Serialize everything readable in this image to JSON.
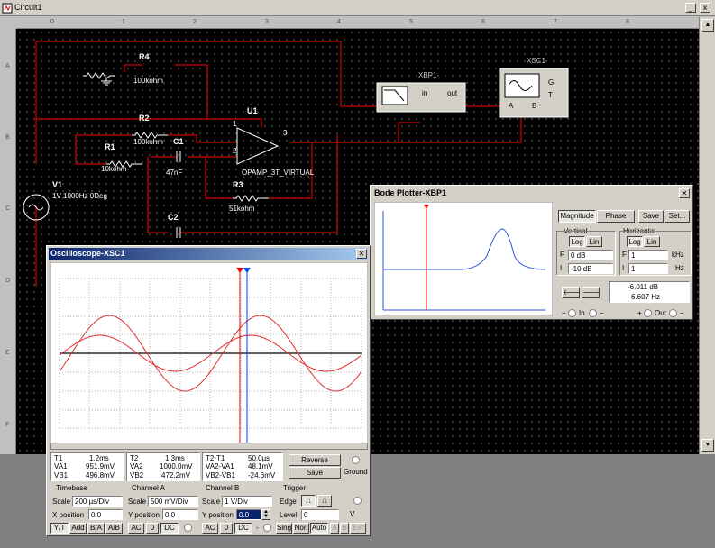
{
  "window": {
    "title": "Circuit1",
    "min": "_",
    "close": "x"
  },
  "ruler": {
    "cols": [
      "0",
      "1",
      "2",
      "3",
      "4",
      "5",
      "6",
      "7",
      "8"
    ],
    "rows": [
      "A",
      "B",
      "C",
      "D",
      "E",
      "F"
    ]
  },
  "schematic": {
    "r4": {
      "name": "R4",
      "value": "100kohm"
    },
    "r2": {
      "name": "R2",
      "value": "100kohm"
    },
    "r1": {
      "name": "R1",
      "value": "10kohm"
    },
    "c1": {
      "name": "C1",
      "value": "47nF"
    },
    "r3": {
      "name": "R3",
      "value": "51kohm"
    },
    "c2": {
      "name": "C2"
    },
    "u1": {
      "name": "U1",
      "model": "OPAMP_3T_VIRTUAL",
      "pin1": "1",
      "pin2": "2",
      "pin3": "3"
    },
    "v1": {
      "name": "V1",
      "value": "1V 1000Hz 0Deg"
    },
    "xbp1": {
      "name": "XBP1",
      "in": "in",
      "out": "out"
    },
    "xsc1": {
      "name": "XSC1",
      "a": "A",
      "b": "B",
      "g": "G",
      "t": "T"
    }
  },
  "bode": {
    "title": "Bode Plotter-XBP1",
    "magnitude": "Magnitude",
    "phase": "Phase",
    "save": "Save",
    "set": "Set...",
    "vertical": {
      "label": "Vertical",
      "log": "Log",
      "lin": "Lin",
      "f_label": "F",
      "f_value": "0 dB",
      "i_label": "I",
      "i_value": "-10 dB"
    },
    "horizontal": {
      "label": "Horizontal",
      "log": "Log",
      "lin": "Lin",
      "f_label": "F",
      "f_value": "1",
      "f_unit": "kHz",
      "i_label": "I",
      "i_value": "1",
      "i_unit": "Hz"
    },
    "readout_db": "-6.011 dB",
    "readout_hz": "6.607  Hz",
    "in_label": "In",
    "out_label": "Out",
    "plus": "+",
    "minus": "−"
  },
  "scope": {
    "title": "Oscilloscope-XSC1",
    "t1": {
      "label": "T1",
      "time": "1.2ms",
      "va1_label": "VA1",
      "va1": "951.9mV",
      "vb1_label": "VB1",
      "vb1": "496.8mV"
    },
    "t2": {
      "label": "T2",
      "time": "1.3ms",
      "va2_label": "VA2",
      "va2": "1000.0mV",
      "vb2_label": "VB2",
      "vb2": "472.2mV"
    },
    "t21": {
      "label": "T2-T1",
      "time": "50.0µs",
      "vd_a_label": "VA2-VA1",
      "vd_a": "48.1mV",
      "vd_b_label": "VB2-VB1",
      "vd_b": "-24.6mV"
    },
    "reverse": "Reverse",
    "save": "Save",
    "ground": "Ground",
    "timebase": {
      "label": "Timebase",
      "scale_label": "Scale",
      "scale": "200 µs/Div",
      "xpos_label": "X position",
      "xpos": "0.0",
      "yt": "Y/T",
      "add": "Add",
      "ba": "B/A",
      "ab": "A/B"
    },
    "channel_a": {
      "label": "Channel A",
      "scale_label": "Scale",
      "scale": "500 mV/Div",
      "ypos_label": "Y position",
      "ypos": "0.0",
      "ac": "AC",
      "zero": "0",
      "dc": "DC"
    },
    "channel_b": {
      "label": "Channel B",
      "scale_label": "Scale",
      "scale": "1 V/Div",
      "ypos_label": "Y position",
      "ypos": "0.0",
      "ac": "AC",
      "zero": "0",
      "dc": "DC",
      "minus": "-"
    },
    "trigger": {
      "label": "Trigger",
      "edge_label": "Edge",
      "level_label": "Level",
      "level": "0",
      "unit": "V",
      "sing": "Sing.",
      "nor": "Nor.",
      "auto": "Auto",
      "a": "A",
      "b": "B",
      "ext": "Ext"
    }
  },
  "colors": {
    "wire": "#ff0000",
    "trace": "#e03030",
    "cursor1": "#ff0000",
    "cursor2": "#0040ff",
    "component": "#ffffff",
    "instrument_bg": "#d4d0c8"
  }
}
